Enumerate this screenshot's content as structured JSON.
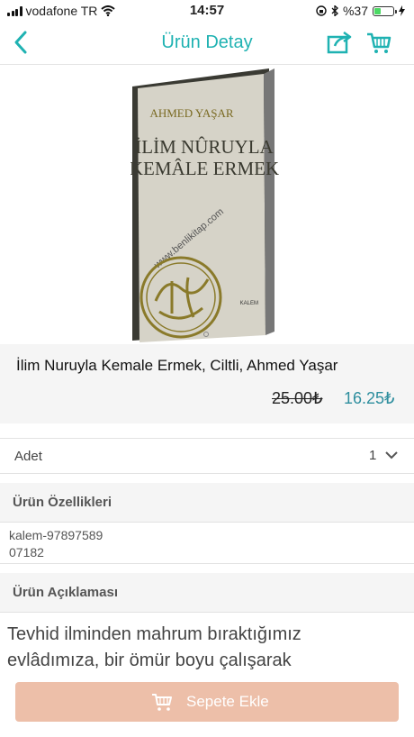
{
  "status_bar": {
    "carrier": "vodafone TR",
    "time": "14:57",
    "battery_text": "%37",
    "battery_level": 0.37
  },
  "nav": {
    "title": "Ürün Detay"
  },
  "book_cover": {
    "author": "AHMED YAŞAR",
    "title_line1": "İLİM NÛRUYLA",
    "title_line2": "KEMÂLE ERMEK",
    "watermark": "www.benlikitap.com",
    "publisher": "KALEM"
  },
  "product": {
    "title": "İlim Nuruyla Kemale Ermek, Ciltli, Ahmed Yaşar",
    "old_price": "25.00₺",
    "new_price": "16.25₺"
  },
  "quantity": {
    "label": "Adet",
    "value": "1"
  },
  "features": {
    "heading": "Ürün Özellikleri",
    "line1": "kalem-97897589",
    "line2": "07182"
  },
  "description": {
    "heading": "Ürün Açıklaması",
    "line1": "Tevhid ilminden mahrum bıraktığımız",
    "line2": "evlâdımıza, bir ömür boyu çalışarak"
  },
  "cart_button": {
    "label": "Sepete Ekle"
  },
  "colors": {
    "accent": "#1fb2b2",
    "price": "#2e8e9e",
    "button": "#edbfa9"
  }
}
